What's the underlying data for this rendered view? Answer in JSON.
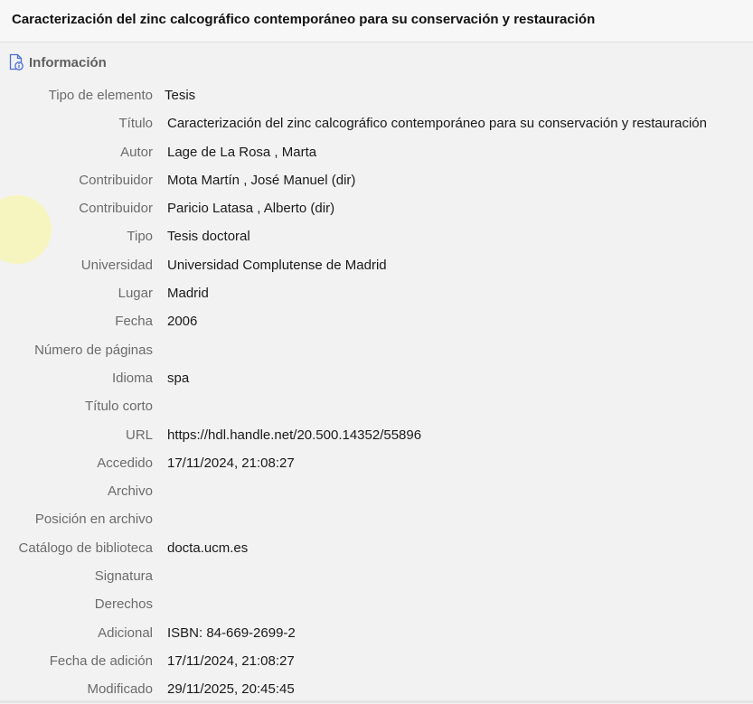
{
  "header": {
    "title": "Caracterización del zinc calcográfico contemporáneo para su conservación y restauración"
  },
  "section": {
    "title": "Información",
    "icon": "document-info-icon"
  },
  "fields": [
    {
      "label": "Tipo de elemento",
      "value": "Tesis"
    },
    {
      "label": "Título",
      "value": "Caracterización del zinc calcográfico contemporáneo para su conservación y restauración"
    },
    {
      "label": "Autor",
      "value": "Lage de La Rosa , Marta"
    },
    {
      "label": "Contribuidor",
      "value": "Mota Martín , José Manuel (dir)"
    },
    {
      "label": "Contribuidor",
      "value": "Paricio Latasa , Alberto (dir)"
    },
    {
      "label": "Tipo",
      "value": "Tesis doctoral"
    },
    {
      "label": "Universidad",
      "value": "Universidad Complutense de Madrid"
    },
    {
      "label": "Lugar",
      "value": "Madrid"
    },
    {
      "label": "Fecha",
      "value": "2006"
    },
    {
      "label": "Número de páginas",
      "value": ""
    },
    {
      "label": "Idioma",
      "value": "spa"
    },
    {
      "label": "Título corto",
      "value": ""
    },
    {
      "label": "URL",
      "value": "https://hdl.handle.net/20.500.14352/55896"
    },
    {
      "label": "Accedido",
      "value": "17/11/2024, 21:08:27"
    },
    {
      "label": "Archivo",
      "value": ""
    },
    {
      "label": "Posición en archivo",
      "value": ""
    },
    {
      "label": "Catálogo de biblioteca",
      "value": "docta.ucm.es"
    },
    {
      "label": "Signatura",
      "value": ""
    },
    {
      "label": "Derechos",
      "value": ""
    },
    {
      "label": "Adicional",
      "value": "ISBN: 84-669-2699-2"
    },
    {
      "label": "Fecha de adición",
      "value": "17/11/2024, 21:08:27"
    },
    {
      "label": "Modificado",
      "value": "29/11/2025, 20:45:45"
    }
  ]
}
